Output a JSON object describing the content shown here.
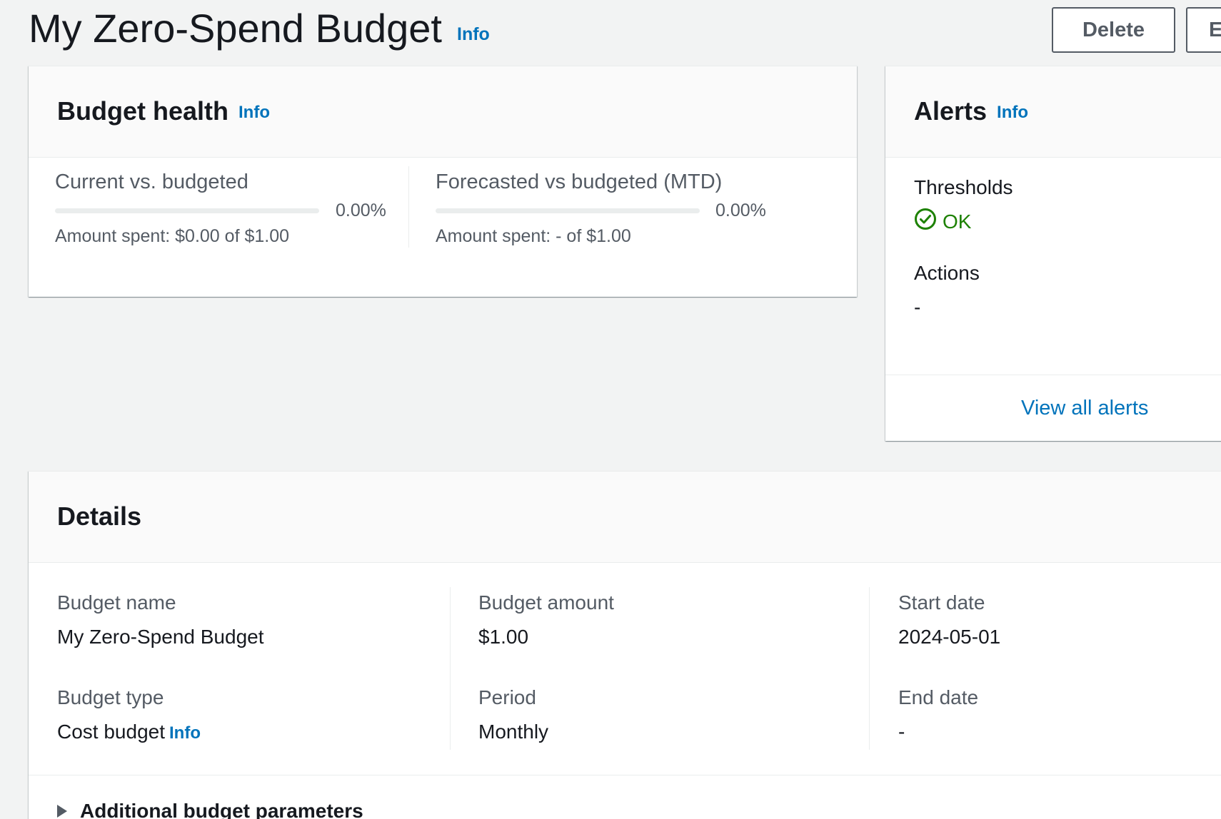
{
  "header": {
    "title": "My Zero-Spend Budget",
    "info_label": "Info",
    "delete_label": "Delete",
    "edit_label": "E"
  },
  "budget_health": {
    "title": "Budget health",
    "info_label": "Info",
    "current": {
      "label": "Current vs. budgeted",
      "percent_text": "0.00%",
      "percent": 0,
      "amount_text": "Amount spent: $0.00 of $1.00"
    },
    "forecast": {
      "label": "Forecasted vs budgeted (MTD)",
      "percent_text": "0.00%",
      "percent": 0,
      "amount_text": "Amount spent: - of $1.00"
    }
  },
  "alerts": {
    "title": "Alerts",
    "info_label": "Info",
    "thresholds_label": "Thresholds",
    "thresholds_status": "OK",
    "actions_label": "Actions",
    "actions_value": "-",
    "view_all_label": "View all alerts"
  },
  "details": {
    "title": "Details",
    "budget_name_label": "Budget name",
    "budget_name_value": "My Zero-Spend Budget",
    "budget_type_label": "Budget type",
    "budget_type_value": "Cost budget",
    "budget_type_info": "Info",
    "budget_amount_label": "Budget amount",
    "budget_amount_value": "$1.00",
    "period_label": "Period",
    "period_value": "Monthly",
    "start_date_label": "Start date",
    "start_date_value": "2024-05-01",
    "end_date_label": "End date",
    "end_date_value": "-",
    "additional_params_label": "Additional budget parameters"
  },
  "colors": {
    "link": "#0073bb",
    "ok": "#1d8102",
    "background": "#f2f3f3"
  },
  "icons": {
    "ok_status": "check-circle-icon",
    "expander": "caret-right-icon"
  }
}
